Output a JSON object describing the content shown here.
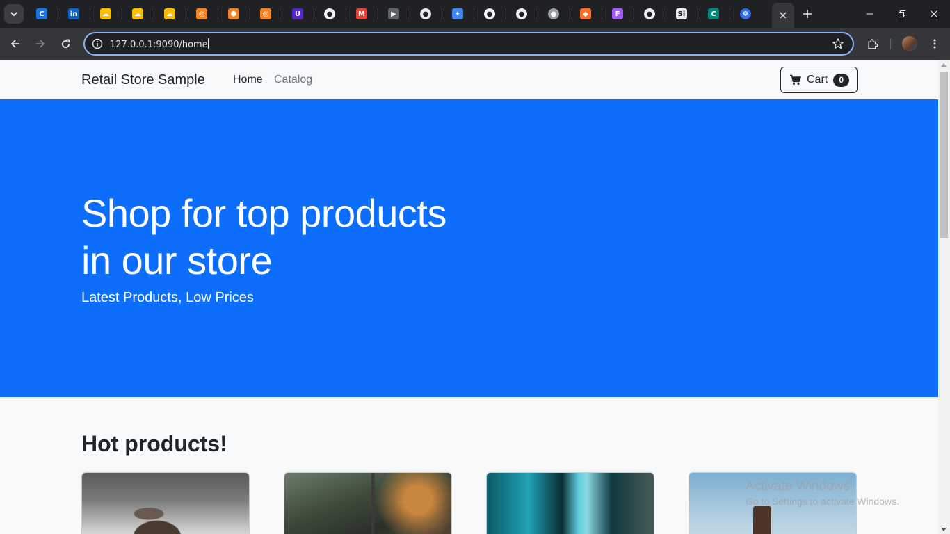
{
  "browser": {
    "active_tab_close": "×",
    "new_tab": "+",
    "url": "127.0.0.1:9090/home",
    "pinned_tabs": [
      {
        "icon": "c-letter-icon",
        "color": "#1a73e8",
        "glyph": "C"
      },
      {
        "icon": "linkedin-icon",
        "color": "#0a66c2",
        "glyph": "in"
      },
      {
        "icon": "google-cloud-icon",
        "color": "#fbbc04",
        "glyph": "☁"
      },
      {
        "icon": "google-cloud-icon",
        "color": "#fbbc04",
        "glyph": "☁"
      },
      {
        "icon": "google-cloud-icon",
        "color": "#fbbc04",
        "glyph": "☁"
      },
      {
        "icon": "orange-square-icon",
        "color": "#f58220",
        "glyph": "◎"
      },
      {
        "icon": "orange-hexagon-icon",
        "color": "#f58220",
        "glyph": "⬢"
      },
      {
        "icon": "orange-square-icon",
        "color": "#f58220",
        "glyph": "◎"
      },
      {
        "icon": "udemy-icon",
        "color": "#5624d0",
        "glyph": "U"
      },
      {
        "icon": "github-icon",
        "color": "#202124",
        "glyph": "●"
      },
      {
        "icon": "gmail-icon",
        "color": "#ea4335",
        "glyph": "M"
      },
      {
        "icon": "video-icon",
        "color": "#5f6368",
        "glyph": "▶"
      },
      {
        "icon": "chat-bot-icon",
        "color": "#ffffff",
        "glyph": "●"
      },
      {
        "icon": "gemini-icon",
        "color": "#4285f4",
        "glyph": "✦"
      },
      {
        "icon": "github-icon",
        "color": "#202124",
        "glyph": "●"
      },
      {
        "icon": "github-icon",
        "color": "#202124",
        "glyph": "●"
      },
      {
        "icon": "globe-icon",
        "color": "#9aa0a6",
        "glyph": "●"
      },
      {
        "icon": "gitlab-icon",
        "color": "#fc6d26",
        "glyph": "◆"
      },
      {
        "icon": "figma-icon",
        "color": "#a259ff",
        "glyph": "F"
      },
      {
        "icon": "github-icon",
        "color": "#202124",
        "glyph": "●"
      },
      {
        "icon": "si-icon",
        "color": "#ffffff",
        "glyph": "Si"
      },
      {
        "icon": "c-green-icon",
        "color": "#00897b",
        "glyph": "C"
      },
      {
        "icon": "kubernetes-icon",
        "color": "#326ce5",
        "glyph": "☸"
      }
    ]
  },
  "page": {
    "brand": "Retail Store Sample",
    "nav": {
      "home": "Home",
      "catalog": "Catalog"
    },
    "cart": {
      "label": "Cart",
      "count": "0"
    },
    "hero": {
      "title_line1": "Shop for top products",
      "title_line2": "in our store",
      "subtitle": "Latest Products, Low Prices"
    },
    "section_title": "Hot products!",
    "watermark": {
      "line1": "Activate Windows",
      "line2": "Go to Settings to activate Windows."
    }
  },
  "colors": {
    "hero_bg": "#0d6efd",
    "page_bg": "#f8f9fa",
    "text_dark": "#212529",
    "muted": "#6c757d"
  }
}
